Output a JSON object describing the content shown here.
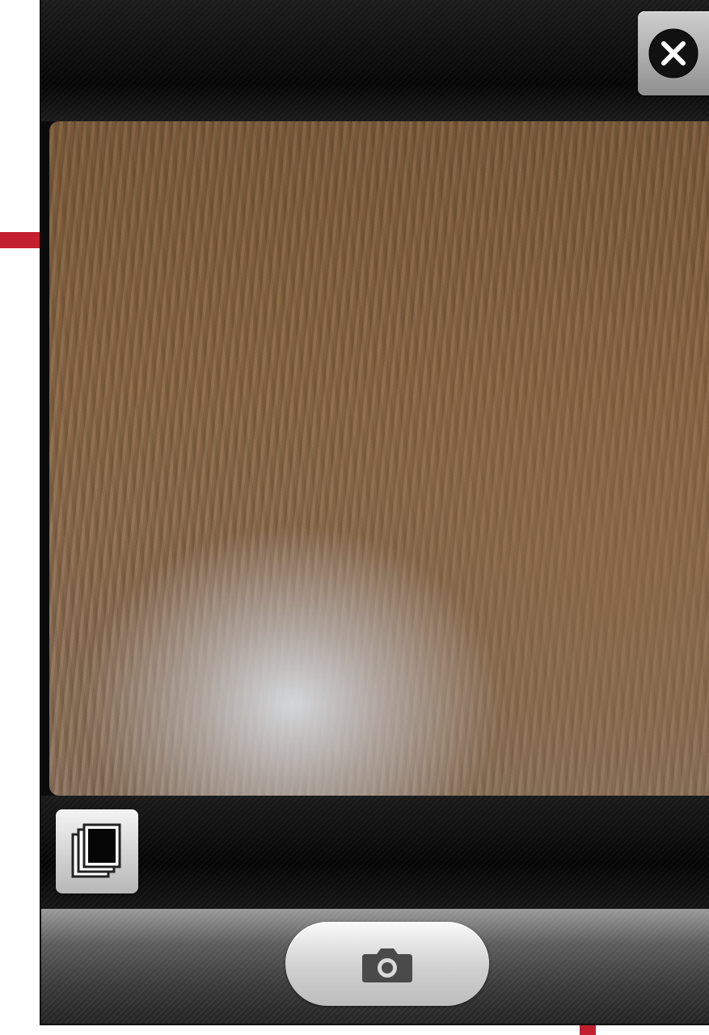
{
  "app": {
    "screen": "camera-capture"
  },
  "top_bar": {
    "close_button": {
      "icon": "close-icon"
    }
  },
  "viewfinder": {
    "content": "live-camera-preview"
  },
  "bottom_strip": {
    "gallery_button": {
      "icon": "photo-stack-icon"
    }
  },
  "control_bar": {
    "shutter_button": {
      "icon": "camera-icon"
    }
  },
  "colors": {
    "accent": "#c41f2f",
    "chrome_dark": "#0b0b0b",
    "button_light": "#e6e6e6"
  }
}
